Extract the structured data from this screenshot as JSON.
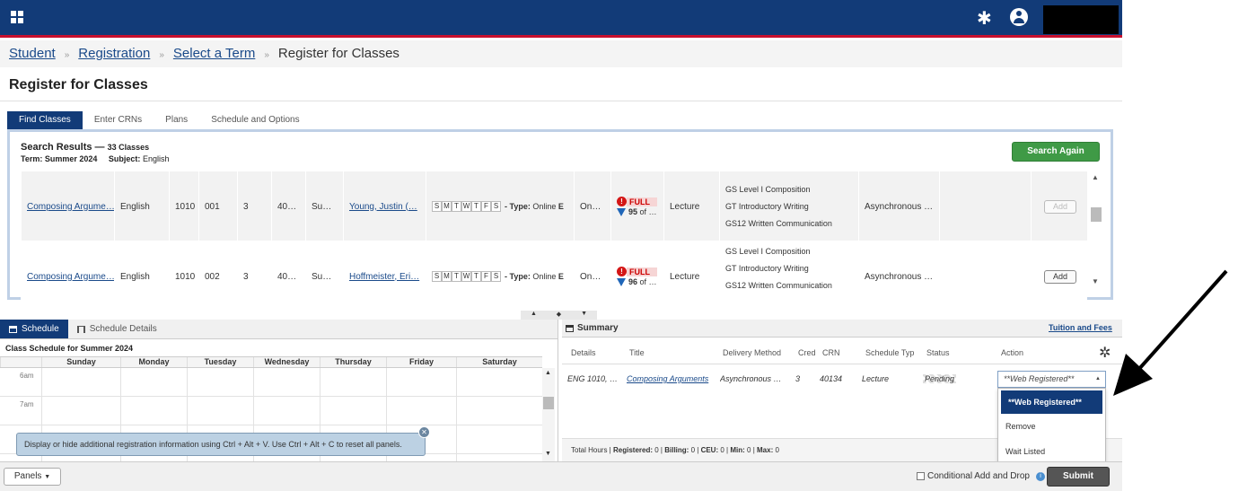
{
  "breadcrumb": [
    "Student",
    "Registration",
    "Select a Term"
  ],
  "breadcrumb_current": "Register for Classes",
  "breadcrumb_sep": "»",
  "page_title": "Register for Classes",
  "tabs": [
    "Find Classes",
    "Enter CRNs",
    "Plans",
    "Schedule and Options"
  ],
  "results": {
    "heading": "Search Results — ",
    "count": "33 Classes",
    "term_label": "Term:",
    "term": "Summer 2024",
    "subject_label": "Subject:",
    "subject": "English",
    "search_again": "Search Again",
    "rows": [
      {
        "title": "Composing Argume…",
        "subject": "English",
        "course": "1010",
        "section": "001",
        "hours": "3",
        "crn": "40…",
        "term": "Su…",
        "instructor": "Young, Justin (…",
        "days": [
          "S",
          "M",
          "T",
          "W",
          "T",
          "F",
          "S"
        ],
        "type_label": "- Type:",
        "type": "Online",
        "type_tail": "E",
        "campus": "On…",
        "status": "FULL",
        "seats": "95",
        "seats_tail": "of …",
        "schedule_type": "Lecture",
        "attributes": [
          "GS Level I Composition",
          "GT Introductory Writing",
          "GS12 Written Communication"
        ],
        "method": "Asynchronous …",
        "add": "Add"
      },
      {
        "title": "Composing Argume…",
        "subject": "English",
        "course": "1010",
        "section": "002",
        "hours": "3",
        "crn": "40…",
        "term": "Su…",
        "instructor": "Hoffmeister, Eri…",
        "days": [
          "S",
          "M",
          "T",
          "W",
          "T",
          "F",
          "S"
        ],
        "type_label": "- Type:",
        "type": "Online",
        "type_tail": "E",
        "campus": "On…",
        "status": "FULL",
        "seats": "96",
        "seats_tail": "of …",
        "schedule_type": "Lecture",
        "attributes": [
          "GS Level I Composition",
          "GT Introductory Writing",
          "GS12 Written Communication"
        ],
        "method": "Asynchronous …",
        "add": "Add"
      }
    ]
  },
  "schedule": {
    "tabs": [
      "Schedule",
      "Schedule Details"
    ],
    "title": "Class Schedule for Summer 2024",
    "days": [
      "Sunday",
      "Monday",
      "Tuesday",
      "Wednesday",
      "Thursday",
      "Friday",
      "Saturday"
    ],
    "hours": [
      "6am",
      "7am"
    ],
    "tip": "Display or hide additional registration information using Ctrl + Alt + V. Use Ctrl + Alt + C to reset all panels."
  },
  "summary": {
    "title": "Summary",
    "tuition": "Tuition and Fees",
    "columns": [
      "Details",
      "Title",
      "Delivery Method",
      "Cred",
      "CRN",
      "Schedule Typ",
      "Status",
      "Action"
    ],
    "row": {
      "details": "ENG 1010, …",
      "title": "Composing Arguments",
      "method": "Asynchronous …",
      "cred": "3",
      "crn": "40134",
      "schedule_type": "Lecture",
      "status": "Pending"
    },
    "totals": {
      "prefix": "Total Hours |",
      "registered_label": "Registered:",
      "registered": "0",
      "billing_label": "Billing:",
      "billing": "0",
      "ceu_label": "CEU:",
      "ceu": "0",
      "min_label": "Min:",
      "min": "0",
      "max_label": "Max:",
      "max": "0"
    },
    "action_value": "**Web Registered**",
    "action_options": [
      "**Web Registered**",
      "Remove",
      "Wait Listed"
    ]
  },
  "footer": {
    "panels": "Panels",
    "conditional": "Conditional Add and Drop",
    "submit": "Submit"
  },
  "colors": {
    "header": "#123b78",
    "header_rule": "#c8102e",
    "search_again": "#3f9a46",
    "full": "#d41616"
  }
}
